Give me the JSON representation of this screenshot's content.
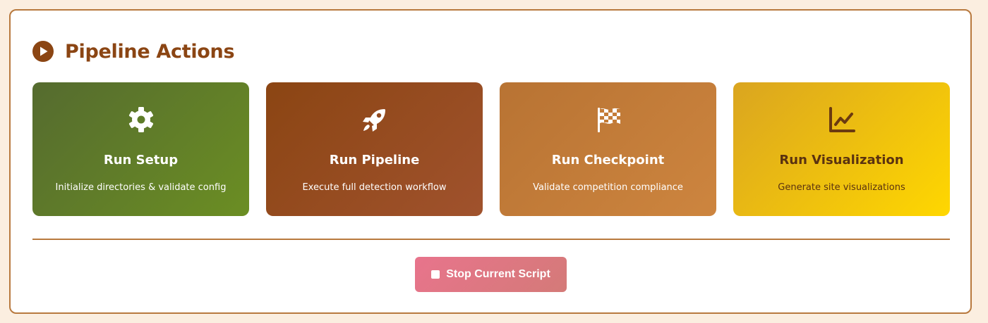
{
  "header": {
    "title": "Pipeline Actions",
    "icon": "play-circle-icon",
    "color": "#8b4513"
  },
  "actions": [
    {
      "icon": "gear-icon",
      "title": "Run Setup",
      "description": "Initialize directories & validate config",
      "gradient": [
        "#556b2f",
        "#6b8e23"
      ]
    },
    {
      "icon": "rocket-icon",
      "title": "Run Pipeline",
      "description": "Execute full detection workflow",
      "gradient": [
        "#8b4513",
        "#a0522d"
      ]
    },
    {
      "icon": "checkered-flag-icon",
      "title": "Run Checkpoint",
      "description": "Validate competition compliance",
      "gradient": [
        "#b87333",
        "#cd853f"
      ]
    },
    {
      "icon": "line-chart-icon",
      "title": "Run Visualization",
      "description": "Generate site visualizations",
      "gradient": [
        "#daa520",
        "#ffd700"
      ]
    }
  ],
  "stop_button": {
    "label": "Stop Current Script",
    "icon": "stop-icon",
    "color": "#e8748c"
  }
}
